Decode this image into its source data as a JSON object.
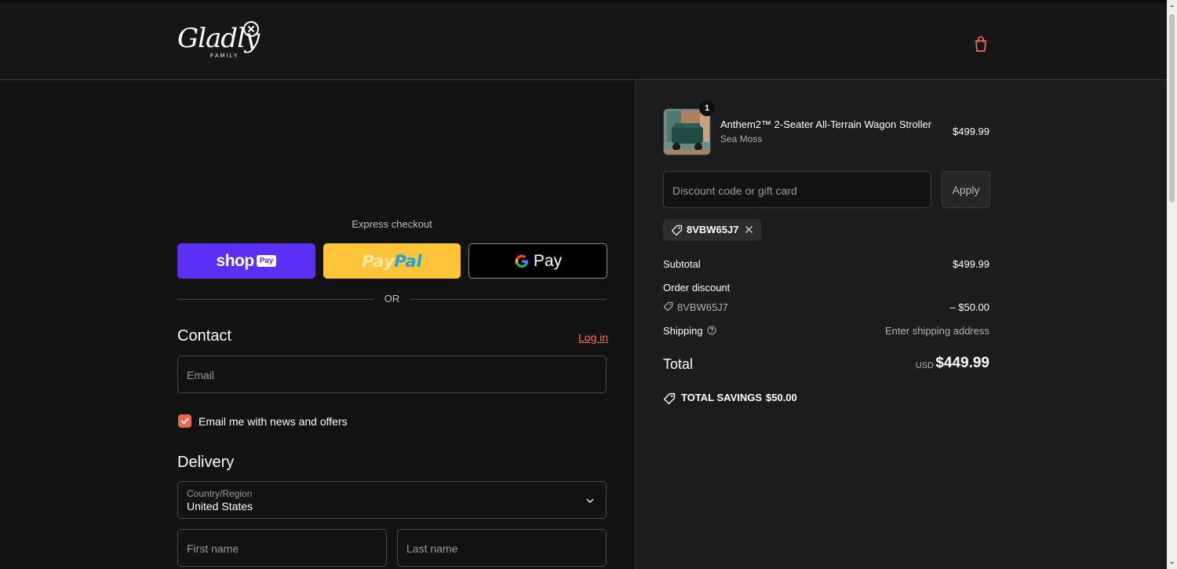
{
  "header": {
    "logo_text": "Gladly",
    "logo_sub": "FAMILY",
    "cart_icon": "shopping-bag-icon"
  },
  "express": {
    "label": "Express checkout",
    "shop_pay": {
      "word": "shop",
      "tag": "Pay"
    },
    "paypal": {
      "pay": "Pay",
      "pal": "Pal"
    },
    "gpay": {
      "g": "G",
      "word": "Pay"
    }
  },
  "divider": {
    "or": "OR"
  },
  "contact": {
    "title": "Contact",
    "login": "Log in",
    "email_placeholder": "Email",
    "newsletter_label": "Email me with news and offers",
    "newsletter_checked": true
  },
  "delivery": {
    "title": "Delivery",
    "country_label": "Country/Region",
    "country_value": "United States",
    "first_name_placeholder": "First name",
    "last_name_placeholder": "Last name"
  },
  "summary": {
    "item": {
      "quantity": "1",
      "name": "Anthem2™ 2-Seater All-Terrain Wagon Stroller",
      "variant": "Sea Moss",
      "price": "$499.99"
    },
    "discount_placeholder": "Discount code or gift card",
    "apply_label": "Apply",
    "applied_code": "8VBW65J7",
    "subtotal_label": "Subtotal",
    "subtotal_value": "$499.99",
    "order_discount_label": "Order discount",
    "order_discount_code": "8VBW65J7",
    "order_discount_value": "– $50.00",
    "shipping_label": "Shipping",
    "shipping_value": "Enter shipping address",
    "total_label": "Total",
    "total_currency": "USD",
    "total_value": "$449.99",
    "savings_label": "TOTAL SAVINGS",
    "savings_value": "$50.00"
  },
  "colors": {
    "accent": "#e66a4f",
    "shop_pay": "#5a31f4",
    "paypal": "#ffc439",
    "link": "#ff6b4a"
  }
}
